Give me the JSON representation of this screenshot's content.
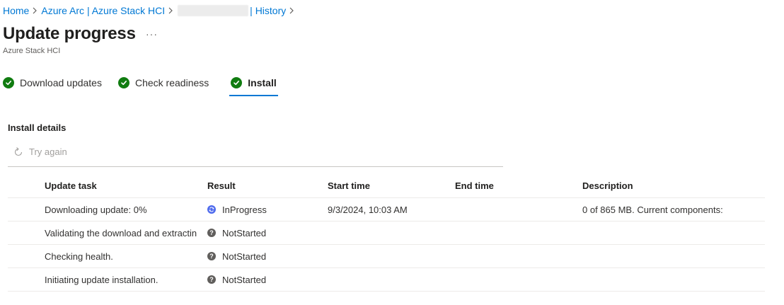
{
  "breadcrumb": {
    "items": [
      "Home",
      "Azure Arc | Azure Stack HCI",
      "| History"
    ]
  },
  "page": {
    "title": "Update progress",
    "more": "···",
    "subtitle": "Azure Stack HCI"
  },
  "steps": [
    {
      "label": "Download updates",
      "status": "complete"
    },
    {
      "label": "Check readiness",
      "status": "complete"
    },
    {
      "label": "Install",
      "status": "complete",
      "active": true
    }
  ],
  "install_details": {
    "title": "Install details",
    "try_again_label": "Try again",
    "columns": [
      "Update task",
      "Result",
      "Start time",
      "End time",
      "Description"
    ],
    "rows": [
      {
        "task": "Downloading update: 0%",
        "result": "InProgress",
        "result_icon": "in-progress-icon",
        "start": "9/3/2024, 10:03 AM",
        "end": "",
        "description": "0 of 865 MB. Current components:"
      },
      {
        "task": "Validating the download and extractin",
        "result": "NotStarted",
        "result_icon": "not-started-icon",
        "start": "",
        "end": "",
        "description": ""
      },
      {
        "task": "Checking health.",
        "result": "NotStarted",
        "result_icon": "not-started-icon",
        "start": "",
        "end": "",
        "description": ""
      },
      {
        "task": "Initiating update installation.",
        "result": "NotStarted",
        "result_icon": "not-started-icon",
        "start": "",
        "end": "",
        "description": ""
      }
    ]
  },
  "colors": {
    "link": "#0078d4",
    "success": "#107c10",
    "in_progress": "#4f6bed",
    "not_started": "#605e5c"
  }
}
